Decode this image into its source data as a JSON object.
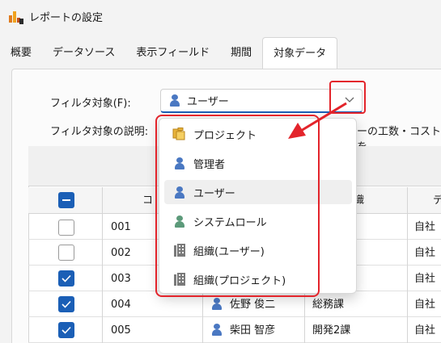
{
  "window": {
    "title": "レポートの設定"
  },
  "tabs": [
    "概要",
    "データソース",
    "表示フィールド",
    "期間",
    "対象データ"
  ],
  "filter": {
    "target_label": "フィルタ対象(F):",
    "target_value": "ユーザー",
    "desc_label": "フィルタ対象の説明:",
    "desc_text": "ーの工数・コストを"
  },
  "dropdown": {
    "items": [
      {
        "label": "プロジェクト",
        "icon": "project-icon"
      },
      {
        "label": "管理者",
        "icon": "person-icon"
      },
      {
        "label": "ユーザー",
        "icon": "person-icon",
        "selected": true
      },
      {
        "label": "システムロール",
        "icon": "role-icon"
      },
      {
        "label": "組織(ユーザー)",
        "icon": "building-icon"
      },
      {
        "label": "組織(プロジェクト)",
        "icon": "building-icon"
      }
    ]
  },
  "grid": {
    "headers": {
      "code": "コ",
      "org": "織",
      "extra": "デ"
    },
    "rows": [
      {
        "checked": false,
        "code": "001",
        "name": "",
        "org": "",
        "extra": "自社"
      },
      {
        "checked": false,
        "code": "002",
        "name": "",
        "org": "",
        "extra": "自社"
      },
      {
        "checked": true,
        "code": "003",
        "name": "",
        "org": "",
        "extra": "自社"
      },
      {
        "checked": true,
        "code": "004",
        "name": "佐野 俊二",
        "org": "総務課",
        "extra": "自社"
      },
      {
        "checked": true,
        "code": "005",
        "name": "柴田 智彦",
        "org": "開発2課",
        "extra": "自社"
      }
    ]
  },
  "colors": {
    "accent": "#1b5fb6",
    "highlight": "#e3242b",
    "person_blue": "#4a78c2",
    "role_green": "#5c9a7a"
  }
}
